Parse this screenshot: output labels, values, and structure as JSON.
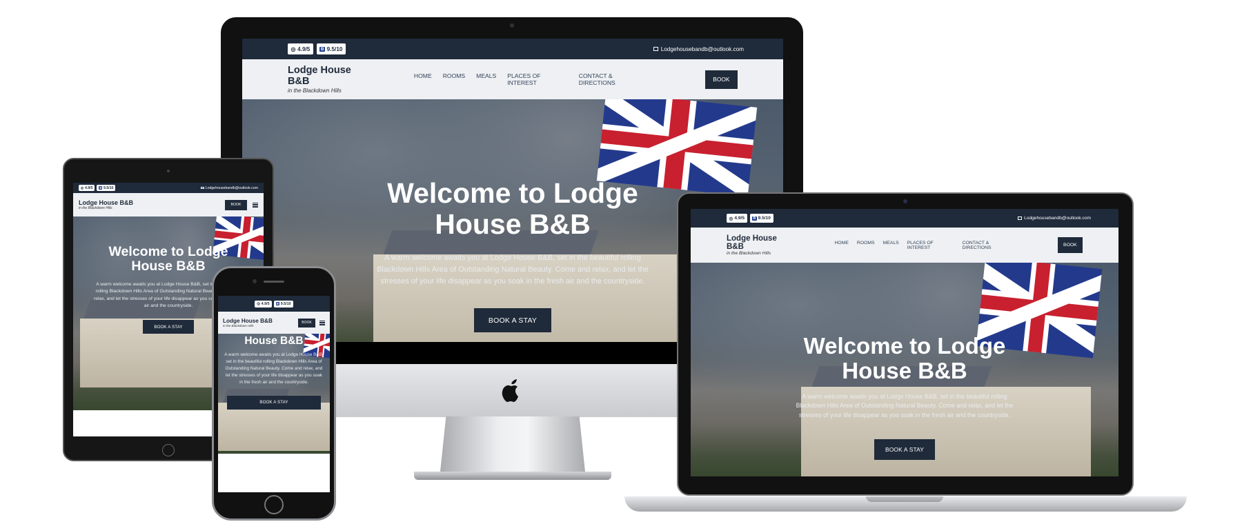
{
  "site": {
    "rating_tripadvisor": "4.9/5",
    "rating_booking": "9.5/10",
    "booking_letter": "B",
    "email": "Lodgehousebandb@outlook.com",
    "logo_title": "Lodge House B&B",
    "logo_subtitle": "in the Blackdown Hills",
    "nav": [
      "HOME",
      "ROOMS",
      "MEALS",
      "PLACES OF INTEREST",
      "CONTACT & DIRECTIONS"
    ],
    "book_label": "BOOK",
    "hero_title": "Welcome to Lodge House B&B",
    "hero_title_line1": "Welcome to Lodge",
    "hero_title_line2": "House B&B",
    "hero_text": "A warm welcome awaits you at Lodge House B&B, set in the beautiful rolling Blackdown Hills Area of Outstanding Natural Beauty. Come and relax, and let the stresses of your life disappear as you soak in the fresh air and the countryside.",
    "cta_label": "BOOK A STAY"
  },
  "devices": [
    "desktop-imac",
    "laptop-macbook",
    "tablet-ipad",
    "phone-iphone"
  ],
  "colors": {
    "brand_navy": "#1f2a3a",
    "header_bg": "#eef0f3",
    "flag_blue": "#233a8c",
    "flag_red": "#c8202f"
  }
}
